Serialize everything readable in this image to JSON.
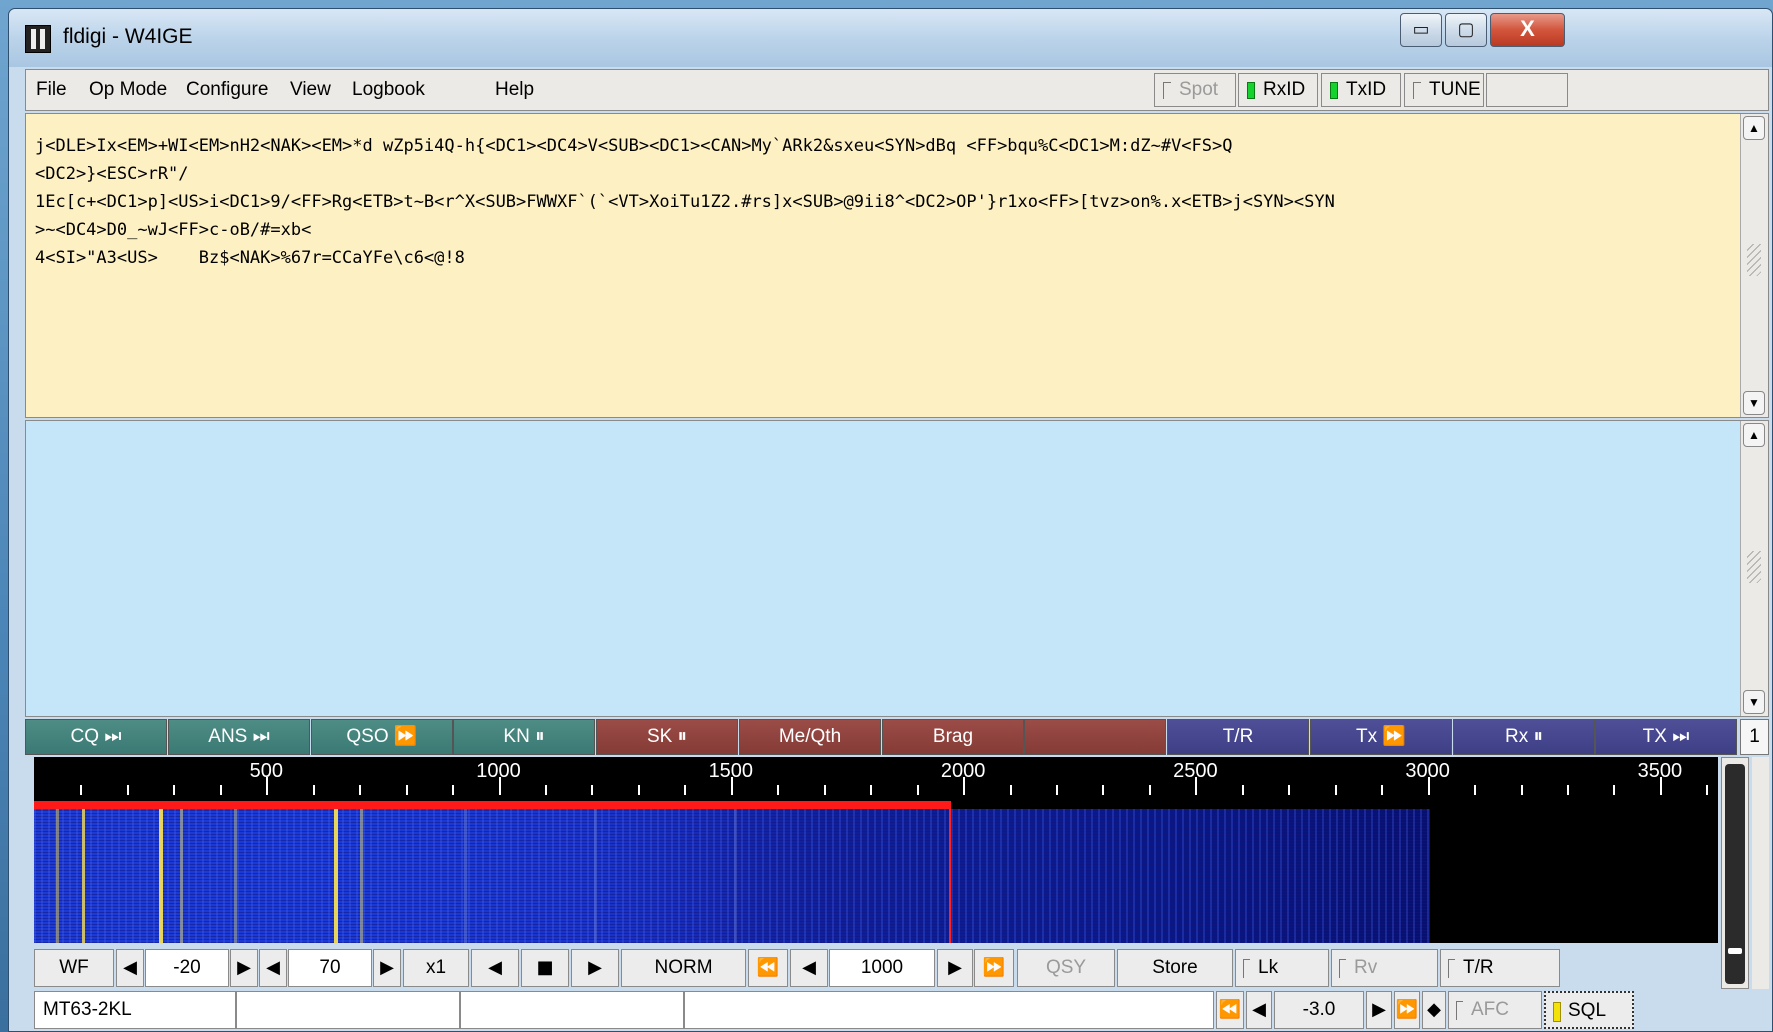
{
  "window": {
    "title": "fldigi - W4IGE",
    "controls": {
      "minimize": "▭",
      "maximize": "▢",
      "close": "X"
    }
  },
  "menu": {
    "file": "File",
    "opmode": "Op Mode",
    "configure": "Configure",
    "view": "View",
    "logbook": "Logbook",
    "help": "Help"
  },
  "toolbar": {
    "spot": "Spot",
    "rxid": "RxID",
    "txid": "TxID",
    "tune": "TUNE"
  },
  "rx_text": "j<DLE>Ix<EM>+WI<EM>nH2<NAK><EM>*d wZp5i4Q-h{<DC1><DC4>V<SUB><DC1><CAN>My`ARk2&sxeu<SYN>dBq <FF>bqu%C<DC1>M:dZ~#V<FS>Q\n<DC2>}<ESC>rR\"/\n1Ec[c+<DC1>p]<US>i<DC1>9/<FF>Rg<ETB>t~B<r^X<SUB>FWWXF`(`<VT>XoiTu1Z2.#rs]x<SUB>@9ii8^<DC2>OP'}r1xo<FF>[tvz>on%.x<ETB>j<SYN><SYN\n>~<DC4>D0_~wJ<FF>c-oB/#=xb<\n4<SI>\"A3<US>    Bz$<NAK>%67r=CCaYFe\\c6<@!8",
  "tx_text": "",
  "macros": [
    {
      "label": "CQ ⏭",
      "color": "teal"
    },
    {
      "label": "ANS ⏭",
      "color": "teal"
    },
    {
      "label": "QSO ⏩",
      "color": "teal"
    },
    {
      "label": "KN ⏸",
      "color": "teal"
    },
    {
      "label": "SK ⏸",
      "color": "red"
    },
    {
      "label": "Me/Qth",
      "color": "red"
    },
    {
      "label": "Brag",
      "color": "red"
    },
    {
      "label": "",
      "color": "red"
    },
    {
      "label": "T/R",
      "color": "blue"
    },
    {
      "label": "Tx ⏩",
      "color": "blue"
    },
    {
      "label": "Rx ⏸",
      "color": "blue"
    },
    {
      "label": "TX ⏭",
      "color": "blue"
    }
  ],
  "macro_bank": "1",
  "scale": {
    "labels": [
      "500",
      "1000",
      "1500",
      "2000",
      "2500",
      "3000",
      "3500"
    ],
    "min_hz": 0,
    "max_hz": 3625,
    "cursor_hz": 1970
  },
  "controls": {
    "wf_mode": "WF",
    "ref_level": "-20",
    "range": "70",
    "zoom": "x1",
    "norm": "NORM",
    "carrier": "1000",
    "qsy": "QSY",
    "store": "Store",
    "lk": "Lk",
    "rv": "Rv",
    "tr": "T/R"
  },
  "status": {
    "mode": "MT63-2KL",
    "field2": "",
    "field3": "",
    "field4": "",
    "afc_offset": "-3.0",
    "afc": "AFC",
    "sql": "SQL"
  },
  "colors": {
    "rx_bg": "#fdf1c4",
    "tx_bg": "#c4e6f8",
    "macro_teal": "#3b7a74",
    "macro_red": "#853b36",
    "macro_blue": "#3e3f85",
    "waterfall_signal": "#e8d24a",
    "led_on": "#16d22f"
  }
}
